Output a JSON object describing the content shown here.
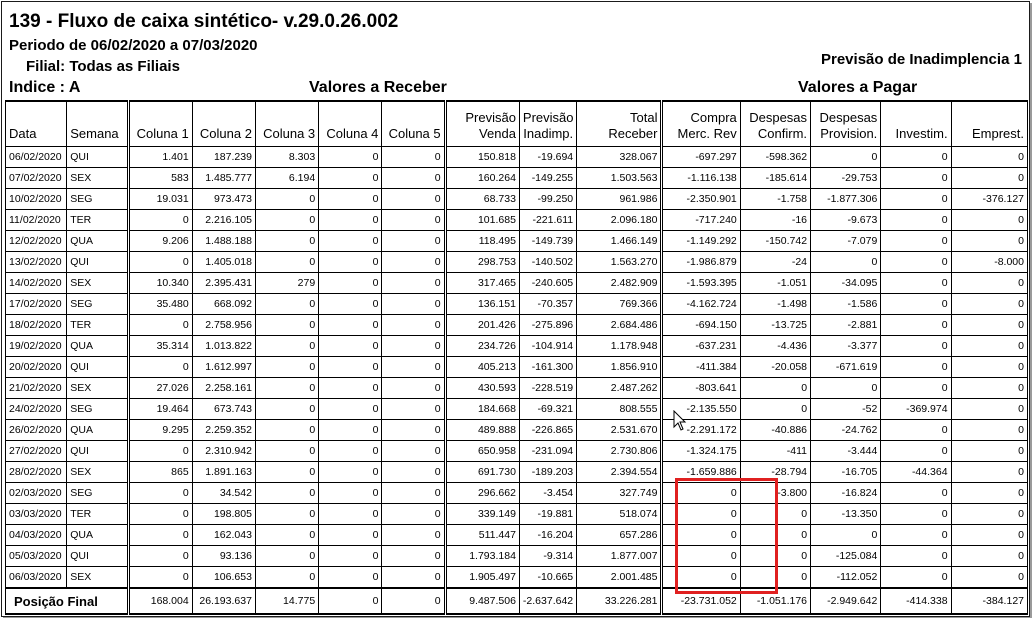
{
  "report": {
    "title": "139 - Fluxo de caixa sintético- v.29.0.26.002",
    "period": "Periodo de 06/02/2020 a 07/03/2020",
    "filial": "Filial: Todas as Filiais",
    "indice": "Indice : A",
    "group_receber": "Valores a Receber",
    "group_pagar": "Valores a Pagar",
    "inadimplencia_title": "Previsão de Inadimplencia 1"
  },
  "columns": [
    "Data",
    "Semana",
    "Coluna 1",
    "Coluna 2",
    "Coluna 3",
    "Coluna 4",
    "Coluna 5",
    "Previsão Venda",
    "Previsão Inadimp.",
    "Total Receber",
    "Compra Merc. Rev",
    "Despesas Confirm.",
    "Despesas Provision.",
    "Investim.",
    "Emprest."
  ],
  "rows": [
    [
      "06/02/2020",
      "QUI",
      "1.401",
      "187.239",
      "8.303",
      "0",
      "0",
      "150.818",
      "-19.694",
      "328.067",
      "-697.297",
      "-598.362",
      "0",
      "0",
      "0"
    ],
    [
      "07/02/2020",
      "SEX",
      "583",
      "1.485.777",
      "6.194",
      "0",
      "0",
      "160.264",
      "-149.255",
      "1.503.563",
      "-1.116.138",
      "-185.614",
      "-29.753",
      "0",
      "0"
    ],
    [
      "10/02/2020",
      "SEG",
      "19.031",
      "973.473",
      "0",
      "0",
      "0",
      "68.733",
      "-99.250",
      "961.986",
      "-2.350.901",
      "-1.758",
      "-1.877.306",
      "0",
      "-376.127"
    ],
    [
      "11/02/2020",
      "TER",
      "0",
      "2.216.105",
      "0",
      "0",
      "0",
      "101.685",
      "-221.611",
      "2.096.180",
      "-717.240",
      "-16",
      "-9.673",
      "0",
      "0"
    ],
    [
      "12/02/2020",
      "QUA",
      "9.206",
      "1.488.188",
      "0",
      "0",
      "0",
      "118.495",
      "-149.739",
      "1.466.149",
      "-1.149.292",
      "-150.742",
      "-7.079",
      "0",
      "0"
    ],
    [
      "13/02/2020",
      "QUI",
      "0",
      "1.405.018",
      "0",
      "0",
      "0",
      "298.753",
      "-140.502",
      "1.563.270",
      "-1.986.879",
      "-24",
      "0",
      "0",
      "-8.000"
    ],
    [
      "14/02/2020",
      "SEX",
      "10.340",
      "2.395.431",
      "279",
      "0",
      "0",
      "317.465",
      "-240.605",
      "2.482.909",
      "-1.593.395",
      "-1.051",
      "-34.095",
      "0",
      "0"
    ],
    [
      "17/02/2020",
      "SEG",
      "35.480",
      "668.092",
      "0",
      "0",
      "0",
      "136.151",
      "-70.357",
      "769.366",
      "-4.162.724",
      "-1.498",
      "-1.586",
      "0",
      "0"
    ],
    [
      "18/02/2020",
      "TER",
      "0",
      "2.758.956",
      "0",
      "0",
      "0",
      "201.426",
      "-275.896",
      "2.684.486",
      "-694.150",
      "-13.725",
      "-2.881",
      "0",
      "0"
    ],
    [
      "19/02/2020",
      "QUA",
      "35.314",
      "1.013.822",
      "0",
      "0",
      "0",
      "234.726",
      "-104.914",
      "1.178.948",
      "-637.231",
      "-4.436",
      "-3.377",
      "0",
      "0"
    ],
    [
      "20/02/2020",
      "QUI",
      "0",
      "1.612.997",
      "0",
      "0",
      "0",
      "405.213",
      "-161.300",
      "1.856.910",
      "-411.384",
      "-20.058",
      "-671.619",
      "0",
      "0"
    ],
    [
      "21/02/2020",
      "SEX",
      "27.026",
      "2.258.161",
      "0",
      "0",
      "0",
      "430.593",
      "-228.519",
      "2.487.262",
      "-803.641",
      "0",
      "0",
      "0",
      "0"
    ],
    [
      "24/02/2020",
      "SEG",
      "19.464",
      "673.743",
      "0",
      "0",
      "0",
      "184.668",
      "-69.321",
      "808.555",
      "-2.135.550",
      "0",
      "-52",
      "-369.974",
      "0"
    ],
    [
      "26/02/2020",
      "QUA",
      "9.295",
      "2.259.352",
      "0",
      "0",
      "0",
      "489.888",
      "-226.865",
      "2.531.670",
      "-2.291.172",
      "-40.886",
      "-24.762",
      "0",
      "0"
    ],
    [
      "27/02/2020",
      "QUI",
      "0",
      "2.310.942",
      "0",
      "0",
      "0",
      "650.958",
      "-231.094",
      "2.730.806",
      "-1.324.175",
      "-411",
      "-3.444",
      "0",
      "0"
    ],
    [
      "28/02/2020",
      "SEX",
      "865",
      "1.891.163",
      "0",
      "0",
      "0",
      "691.730",
      "-189.203",
      "2.394.554",
      "-1.659.886",
      "-28.794",
      "-16.705",
      "-44.364",
      "0"
    ],
    [
      "02/03/2020",
      "SEG",
      "0",
      "34.542",
      "0",
      "0",
      "0",
      "296.662",
      "-3.454",
      "327.749",
      "0",
      "-3.800",
      "-16.824",
      "0",
      "0"
    ],
    [
      "03/03/2020",
      "TER",
      "0",
      "198.805",
      "0",
      "0",
      "0",
      "339.149",
      "-19.881",
      "518.074",
      "0",
      "0",
      "-13.350",
      "0",
      "0"
    ],
    [
      "04/03/2020",
      "QUA",
      "0",
      "162.043",
      "0",
      "0",
      "0",
      "511.447",
      "-16.204",
      "657.286",
      "0",
      "0",
      "0",
      "0",
      "0"
    ],
    [
      "05/03/2020",
      "QUI",
      "0",
      "93.136",
      "0",
      "0",
      "0",
      "1.793.184",
      "-9.314",
      "1.877.007",
      "0",
      "0",
      "-125.084",
      "0",
      "0"
    ],
    [
      "06/03/2020",
      "SEX",
      "0",
      "106.653",
      "0",
      "0",
      "0",
      "1.905.497",
      "-10.665",
      "2.001.485",
      "0",
      "0",
      "-112.052",
      "0",
      "0"
    ]
  ],
  "totals": {
    "label": "Posição Final",
    "values": [
      "168.004",
      "26.193.637",
      "14.775",
      "0",
      "0",
      "9.487.506",
      "-2.637.642",
      "33.226.281",
      "-23.731.052",
      "-1.051.176",
      "-2.949.642",
      "-414.338",
      "-384.127"
    ]
  },
  "highlight_color": "#e02020"
}
